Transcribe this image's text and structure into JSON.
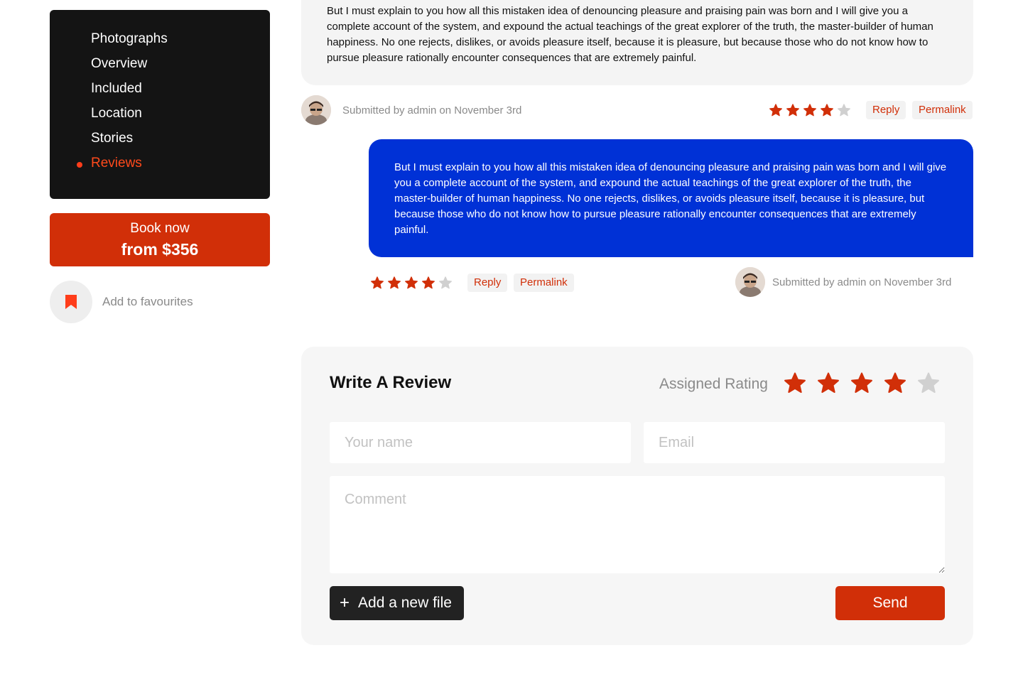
{
  "sidebar": {
    "items": [
      {
        "label": "Photographs",
        "active": false
      },
      {
        "label": "Overview",
        "active": false
      },
      {
        "label": "Included",
        "active": false
      },
      {
        "label": "Location",
        "active": false
      },
      {
        "label": "Stories",
        "active": false
      },
      {
        "label": "Reviews",
        "active": true
      }
    ],
    "book": {
      "line1": "Book now",
      "line2": "from $356"
    },
    "favourite_label": "Add to favourites"
  },
  "review": {
    "text": "But I must explain to you how all this mistaken idea of denouncing pleasure and praising pain was born and I will give you a complete account of the system, and expound the actual teachings of the great explorer of the truth, the master-builder of human happiness. No one rejects, dislikes, or avoids pleasure itself, because it is pleasure, but because those who do not know how to pursue pleasure rationally encounter consequences that are extremely painful.",
    "submitted_by": "Submitted by",
    "author": "admin",
    "date": "on November 3rd",
    "rating": 4,
    "rating_max": 5,
    "reply_label": "Reply",
    "permalink_label": "Permalink"
  },
  "reply": {
    "text": "But I must explain to you how all this mistaken idea of denouncing pleasure and praising pain was born and I will give you a complete account of the system, and expound the actual teachings of the great explorer of the truth, the master-builder of human happiness. No one rejects, dislikes, or avoids pleasure itself, because it is pleasure, but because those who do not know how to pursue pleasure rationally encounter consequences that are extremely painful.",
    "submitted_by": "Submitted by",
    "author": "admin",
    "date": "on November 3rd",
    "rating": 4,
    "rating_max": 5,
    "reply_label": "Reply",
    "permalink_label": "Permalink"
  },
  "write_review": {
    "title": "Write A Review",
    "assigned_label": "Assigned Rating",
    "rating": 4,
    "rating_max": 5,
    "name_placeholder": "Your name",
    "email_placeholder": "Email",
    "comment_placeholder": "Comment",
    "add_file_label": "Add a new file",
    "add_file_icon": "plus-icon",
    "send_label": "Send"
  },
  "colors": {
    "accent": "#d12f08",
    "accent_bright": "#ff4a1c",
    "reply_bubble": "#0031d6",
    "star_empty": "#d0d0d0",
    "sidebar_bg": "#141414"
  }
}
